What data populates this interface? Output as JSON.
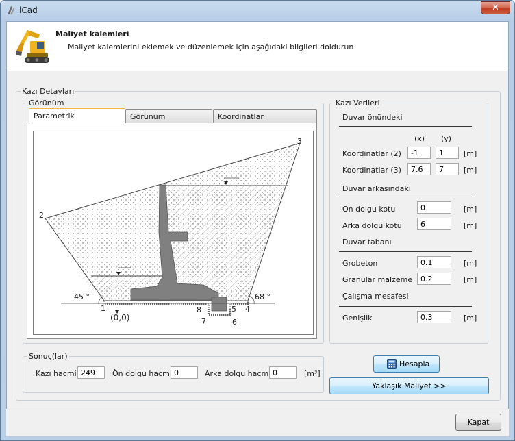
{
  "window": {
    "title": "iCad",
    "close_label": "✕"
  },
  "header": {
    "title": "Maliyet kalemleri",
    "subtitle": "Maliyet kalemlerini eklemek ve düzenlemek için aşağıdaki bilgileri doldurun"
  },
  "kazi_detaylari": {
    "label": "Kazı Detayları",
    "gorunum": {
      "label": "Görünüm",
      "tabs": [
        {
          "label": "Parametrik",
          "active": true
        },
        {
          "label": "Görünüm",
          "active": false
        },
        {
          "label": "Koordinatlar",
          "active": false
        }
      ],
      "diagram_labels": {
        "p1": "1",
        "p2": "2",
        "p3": "3",
        "p4": "4",
        "p5": "5",
        "p6": "6",
        "p7": "7",
        "p8": "8",
        "origin": "(0,0)",
        "angle_left": "45 °",
        "angle_right": "68 °"
      }
    }
  },
  "kazi_verileri": {
    "label": "Kazı Verileri",
    "duvar_onundeki": {
      "label": "Duvar önündeki",
      "col_x": "(x)",
      "col_y": "(y)",
      "rows": [
        {
          "label": "Koordinatlar (2)",
          "x": "-1",
          "y": "1",
          "unit": "[m]"
        },
        {
          "label": "Koordinatlar (3)",
          "x": "7.6",
          "y": "7",
          "unit": "[m]"
        }
      ]
    },
    "duvar_arkasindaki": {
      "label": "Duvar arkasındaki",
      "on_dolgu": {
        "label": "Ön dolgu kotu",
        "value": "0",
        "unit": "[m]"
      },
      "arka_dolgu": {
        "label": "Arka dolgu kotu",
        "value": "6",
        "unit": "[m]"
      }
    },
    "duvar_tabani": {
      "label": "Duvar tabanı",
      "grobeton": {
        "label": "Grobeton",
        "value": "0.1",
        "unit": "[m]"
      },
      "granular": {
        "label": "Granular malzeme",
        "value": "0.2",
        "unit": "[m]"
      }
    },
    "calisma": {
      "label": "Çalışma mesafesi",
      "genislik": {
        "label": "Genişlik",
        "value": "0.3",
        "unit": "[m]"
      }
    }
  },
  "sonuclar": {
    "label": "Sonuç(lar)",
    "kazi_hacmi": {
      "label": "Kazı hacmi",
      "value": "249"
    },
    "on_dolgu_hacmi": {
      "label": "Ön dolgu hacmi",
      "value": "0"
    },
    "arka_dolgu_hacmi": {
      "label": "Arka dolgu hacmi",
      "value": "0"
    },
    "unit": "[m³]"
  },
  "buttons": {
    "hesapla": "Hesapla",
    "yaklasik": "Yaklaşık Maliyet >>",
    "kapat": "Kapat"
  },
  "colors": {
    "accent_tab": "#f2b640",
    "button_blue": "#bee6fd",
    "wall_gray": "#808080"
  }
}
